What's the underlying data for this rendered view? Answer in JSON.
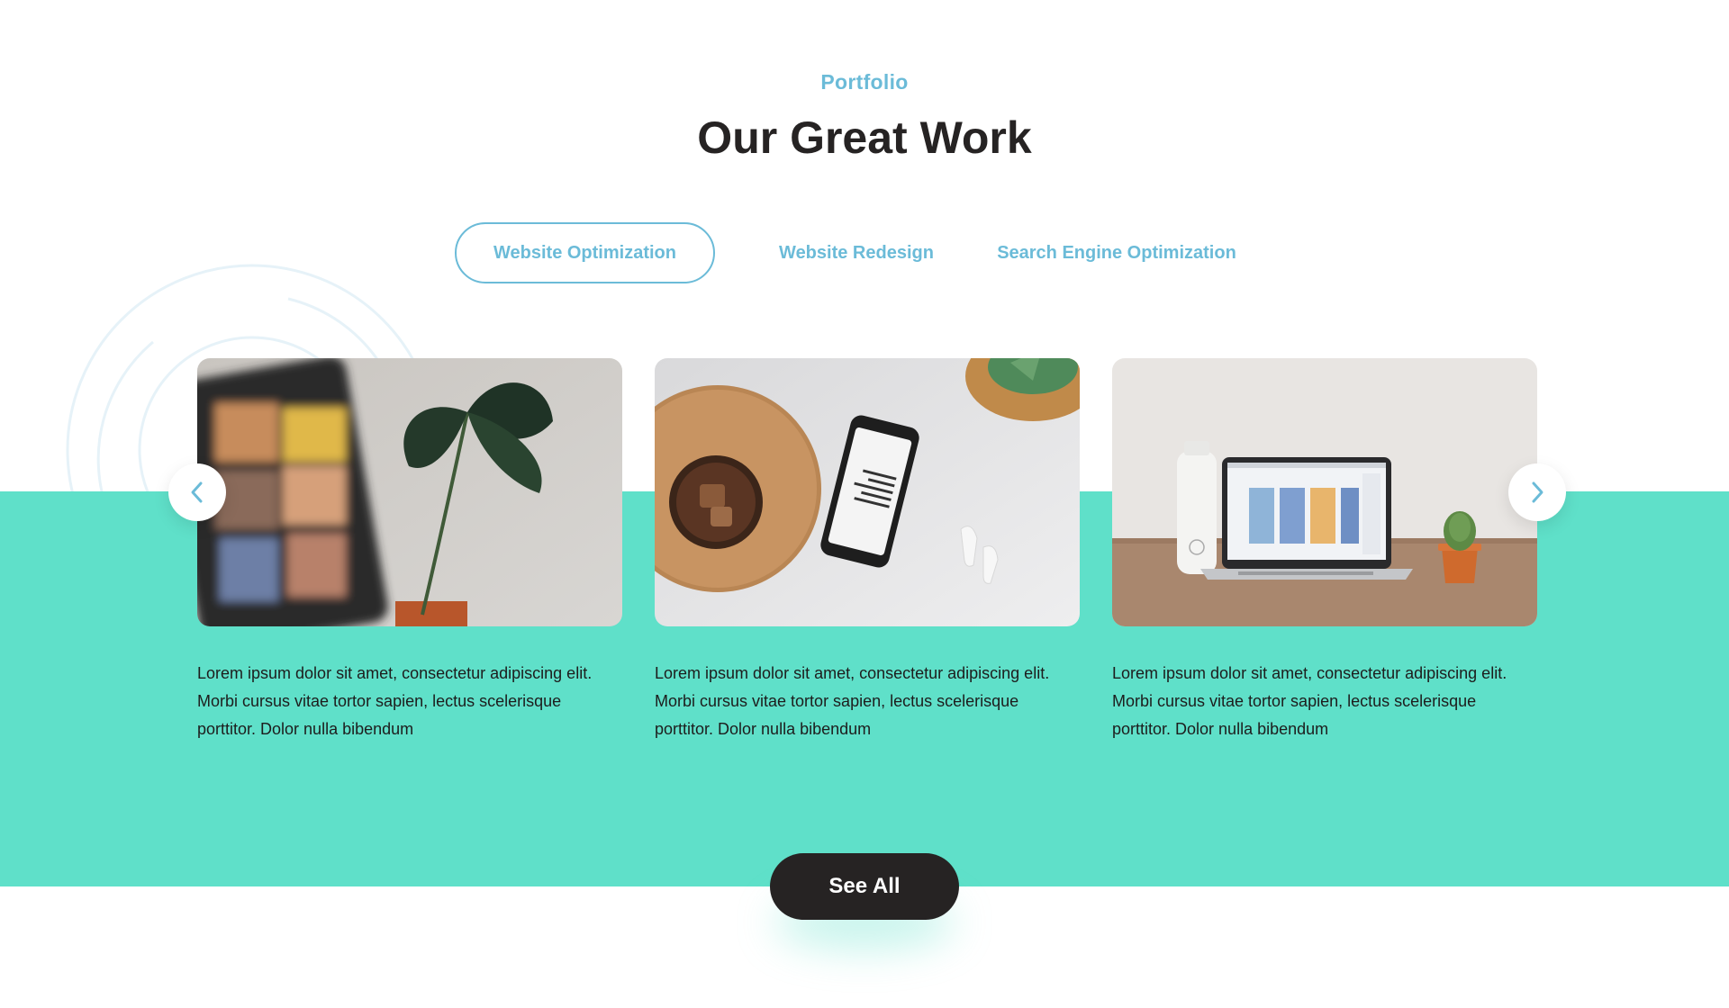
{
  "header": {
    "eyebrow": "Portfolio",
    "title": "Our Great Work"
  },
  "tabs": [
    {
      "label": "Website Optimization",
      "active": true
    },
    {
      "label": "Website Redesign",
      "active": false
    },
    {
      "label": "Search Engine Optimization",
      "active": false
    }
  ],
  "carousel": {
    "prev_icon": "chevron-left-icon",
    "next_icon": "chevron-right-icon",
    "cards": [
      {
        "image": "tablet-video-call-with-plant",
        "text": "Lorem ipsum dolor sit amet, consectetur adipiscing elit. Morbi cursus vitae tortor sapien, lectus scelerisque porttitor. Dolor nulla bibendum"
      },
      {
        "image": "smartphone-with-coffee-and-earbuds",
        "text": "Lorem ipsum dolor sit amet, consectetur adipiscing elit. Morbi cursus vitae tortor sapien, lectus scelerisque porttitor. Dolor nulla bibendum"
      },
      {
        "image": "laptop-on-desk-with-cactus",
        "text": "Lorem ipsum dolor sit amet, consectetur adipiscing elit. Morbi cursus vitae tortor sapien, lectus scelerisque porttitor. Dolor nulla bibendum"
      }
    ]
  },
  "cta": {
    "label": "See All"
  },
  "colors": {
    "accent": "#6bbbd8",
    "teal": "#5fe0c9",
    "dark": "#262323"
  }
}
